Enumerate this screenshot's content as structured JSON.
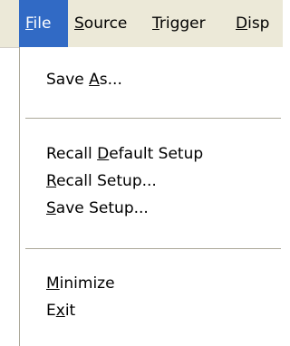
{
  "menubar": {
    "items": [
      {
        "pre": "",
        "ul": "F",
        "post": "ile"
      },
      {
        "pre": "",
        "ul": "S",
        "post": "ource"
      },
      {
        "pre": "",
        "ul": "T",
        "post": "rigger"
      },
      {
        "pre": "",
        "ul": "D",
        "post": "isp"
      }
    ]
  },
  "menu": {
    "save_as": {
      "pre": "Save ",
      "ul": "A",
      "post": "s..."
    },
    "recall_default": {
      "pre": "Recall ",
      "ul": "D",
      "post": "efault Setup"
    },
    "recall_setup": {
      "pre": "",
      "ul": "R",
      "post": "ecall Setup..."
    },
    "save_setup": {
      "pre": "",
      "ul": "S",
      "post": "ave Setup..."
    },
    "minimize": {
      "pre": "",
      "ul": "M",
      "post": "inimize"
    },
    "exit": {
      "pre": "E",
      "ul": "x",
      "post": "it"
    }
  },
  "colors": {
    "highlight": "#316ac5",
    "menubar_bg": "#ece9d8",
    "separator": "#aca899"
  }
}
